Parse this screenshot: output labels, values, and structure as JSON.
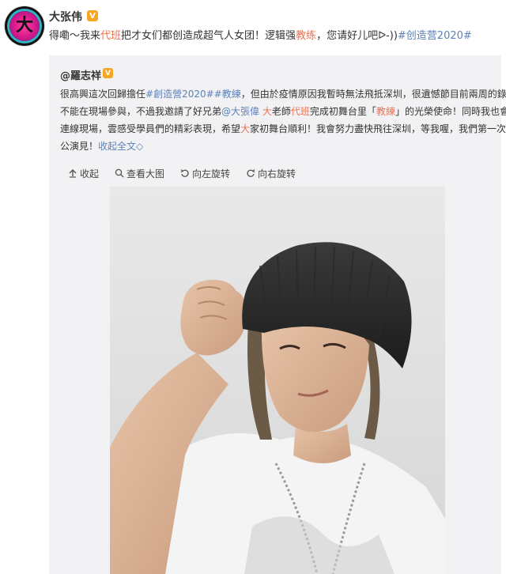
{
  "post": {
    "author": "大张伟",
    "vip_badge": "V",
    "avatar_char": "大",
    "text_parts": [
      {
        "t": "得嘞～我来",
        "k": "plain"
      },
      {
        "t": "代班",
        "k": "link"
      },
      {
        "t": "把才女们都创造成超气人女团！逻辑强",
        "k": "plain"
      },
      {
        "t": "教练",
        "k": "link"
      },
      {
        "t": "，您请好儿吧ᐅ-))",
        "k": "plain"
      },
      {
        "t": "#创造营2020#",
        "k": "tag"
      }
    ]
  },
  "repost": {
    "author": "@羅志祥",
    "vip_badge": "V",
    "lines": [
      [
        {
          "t": "很高興這次回歸擔任",
          "k": "plain"
        },
        {
          "t": "#創造營2020#",
          "k": "tag"
        },
        {
          "t": "#教練",
          "k": "tag"
        },
        {
          "t": "，但由於疫情原因我暫時無法飛抵深圳，很遺憾節目前兩周的錄制",
          "k": "plain"
        }
      ],
      [
        {
          "t": "不能在現場參與，不過我邀請了好兄弟",
          "k": "plain"
        },
        {
          "t": "@大張偉",
          "k": "tag"
        },
        {
          "t": " ",
          "k": "plain"
        },
        {
          "t": "大",
          "k": "link"
        },
        {
          "t": "老師",
          "k": "plain"
        },
        {
          "t": "代班",
          "k": "link"
        },
        {
          "t": "完成初舞台里「",
          "k": "plain"
        },
        {
          "t": "教練",
          "k": "link"
        },
        {
          "t": "」的光榮使命！同時我也會",
          "k": "plain"
        }
      ],
      [
        {
          "t": "連線現場，雲感受學員們的精彩表現，希望",
          "k": "plain"
        },
        {
          "t": "大",
          "k": "link"
        },
        {
          "t": "家初舞台順利！我會努力盡快飛往深圳，等我喔，我們第一次",
          "k": "plain"
        }
      ],
      [
        {
          "t": "公演見！",
          "k": "plain"
        },
        {
          "t": "收起全文",
          "k": "tag"
        },
        {
          "t": "◇",
          "k": "tag"
        }
      ]
    ],
    "toolbar": [
      {
        "icon": "collapse-icon",
        "label": "收起"
      },
      {
        "icon": "magnify-icon",
        "label": "查看大图"
      },
      {
        "icon": "rotate-left-icon",
        "label": "向左旋转"
      },
      {
        "icon": "rotate-right-icon",
        "label": "向右旋转"
      }
    ]
  },
  "colors": {
    "link": "#eb7350",
    "tag": "#5d81b8",
    "repost_bg": "#f2f2f5",
    "vip": "#f5a623"
  }
}
